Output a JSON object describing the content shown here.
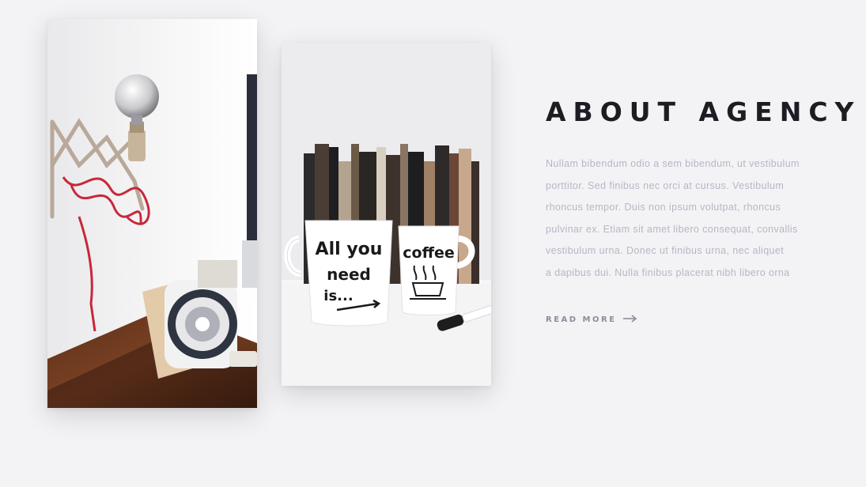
{
  "about": {
    "title": "ABOUT AGENCY",
    "paragraph_lines": [
      "Nullam bibendum odio a sem bibendum, ut vestibulum",
      "porttitor. Sed finibus nec orci at cursus. Vestibulum",
      "rhoncus tempor. Duis non ipsum volutpat, rhoncus",
      "pulvinar ex. Etiam sit amet libero consequat, convallis",
      "vestibulum urna. Donec ut finibus urna, nec aliquet",
      "a dapibus dui. Nulla finibus placerat nibh libero orna"
    ],
    "read_more_label": "READ MORE",
    "read_more_icon": "arrow-right-icon"
  },
  "photos": [
    {
      "name": "desk-lamp-speaker-photo"
    },
    {
      "name": "coffee-mugs-books-photo",
      "mug_left_text": [
        "All you",
        "need",
        "is..."
      ],
      "mug_right_text": "coffee"
    }
  ],
  "colors": {
    "background": "#f3f3f6",
    "title": "#1c1c22",
    "body_text": "#b5b7c4",
    "link": "#8b8d99"
  }
}
